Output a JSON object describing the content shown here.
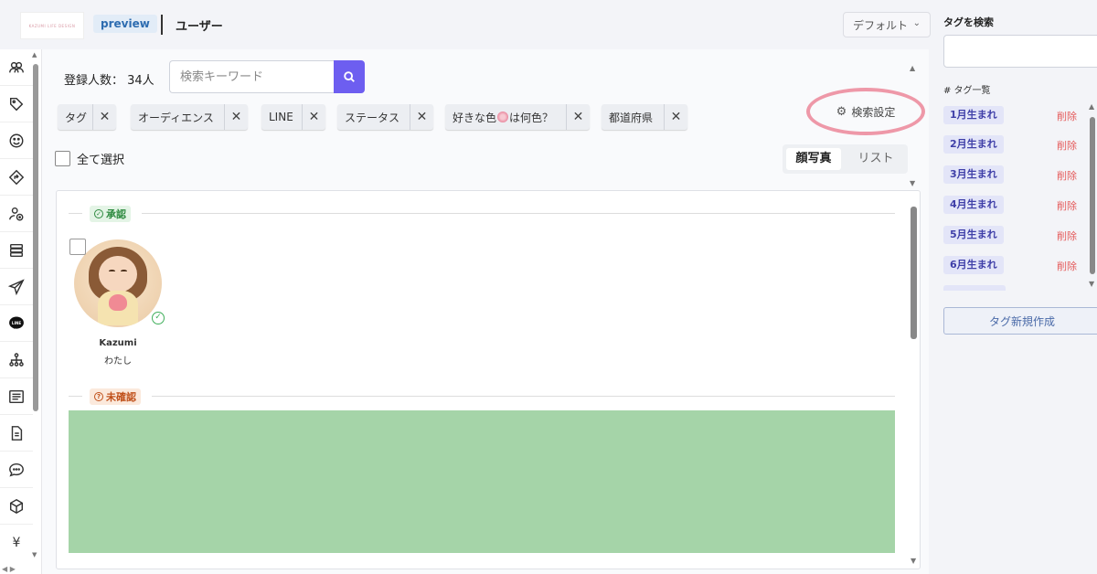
{
  "header": {
    "logo_text": "KAZUMI LIFE DESIGN",
    "preview_badge": "preview",
    "title": "ユーザー",
    "view_select": "デフォルト"
  },
  "sidebar": {
    "items": [
      {
        "icon": "users-icon"
      },
      {
        "icon": "tag-icon"
      },
      {
        "icon": "smile-icon"
      },
      {
        "icon": "diamond-arrow-icon"
      },
      {
        "icon": "user-add-icon"
      },
      {
        "icon": "database-icon"
      },
      {
        "icon": "send-icon"
      },
      {
        "icon": "line-icon",
        "text": "LINE"
      },
      {
        "icon": "sitemap-icon"
      },
      {
        "icon": "list-icon"
      },
      {
        "icon": "document-icon"
      },
      {
        "icon": "chat-icon"
      },
      {
        "icon": "box-icon"
      },
      {
        "icon": "yen-icon",
        "text": "¥"
      }
    ]
  },
  "main": {
    "count_label": "登録人数： 34人",
    "search_placeholder": "検索キーワード",
    "filter_chips": [
      {
        "label": "タグ"
      },
      {
        "label": "オーディエンス"
      },
      {
        "label": "LINE"
      },
      {
        "label": "ステータス"
      },
      {
        "label_before": "好きな色",
        "label_after": "は何色？"
      },
      {
        "label": "都道府県"
      }
    ],
    "search_settings": "検索設定",
    "select_all": "全て選択",
    "view_tabs": {
      "active": "顔写真",
      "inactive": "リスト"
    },
    "sections": {
      "approved": "承認",
      "unconfirmed": "未確認"
    },
    "user_card": {
      "name": "Kazumi",
      "subtitle": "わたし"
    }
  },
  "tag_panel": {
    "search_title": "タグを検索",
    "list_title": "# タグ一覧",
    "delete_label": "削除",
    "tags": [
      "1月生まれ",
      "2月生まれ",
      "3月生まれ",
      "4月生まれ",
      "5月生まれ",
      "6月生まれ"
    ],
    "new_tag_button": "タグ新規作成"
  },
  "colors": {
    "accent": "#6d5ef0",
    "approved_green": "#2d8a3f",
    "unconfirmed_orange": "#c0501a",
    "delete_red": "#e55a5a",
    "highlight_pink": "#ee98a8",
    "placeholder_green": "#a5d4a8"
  }
}
